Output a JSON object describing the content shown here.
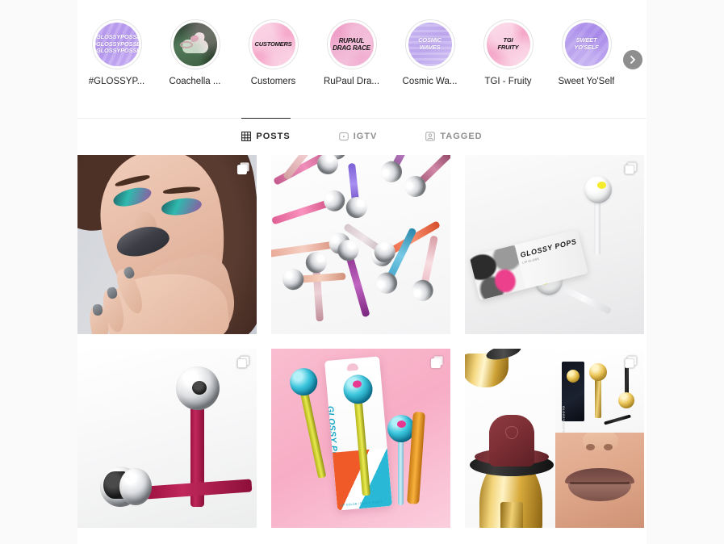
{
  "highlights": {
    "next_label": "Next",
    "items": [
      {
        "label": "#GLOSSYP...",
        "cover_text": "#GLOSSYPOSSE\n#GLOSSYPOSSE\n#GLOSSYPOSSE",
        "cover_class": "cov-glossyposse",
        "accent": "#b79bef"
      },
      {
        "label": "Coachella ...",
        "cover_text": "",
        "cover_class": "cov-coachella",
        "accent": "#3d5c45"
      },
      {
        "label": "Customers",
        "cover_text": "CUSTOMERS",
        "cover_class": "cov-customers",
        "accent": "#f6a9cb"
      },
      {
        "label": "RuPaul Dra...",
        "cover_text": "RUPAUL\nDRAG RACE",
        "cover_class": "cov-rupaul",
        "accent": "#eb96c2"
      },
      {
        "label": "Cosmic Wa...",
        "cover_text": "COSMIC\nWAVES",
        "cover_class": "cov-cosmic",
        "accent": "#bfa9ee"
      },
      {
        "label": "TGI - Fruity",
        "cover_text": "TGI\nFRUITY",
        "cover_class": "cov-tgi",
        "accent": "#f4a6c7"
      },
      {
        "label": "Sweet Yo'Self",
        "cover_text": "SWEET\nYO'SELF",
        "cover_class": "cov-sweet",
        "accent": "#a98bea"
      }
    ]
  },
  "tabs": [
    {
      "label": "POSTS",
      "icon": "grid-icon",
      "active": true
    },
    {
      "label": "IGTV",
      "icon": "igtv-icon",
      "active": false
    },
    {
      "label": "TAGGED",
      "icon": "tagged-icon",
      "active": false
    }
  ],
  "posts": [
    {
      "name": "post-makeup-model",
      "badge": "carousel-icon",
      "alt": "Model with teal smoky eye makeup and grey lipstick"
    },
    {
      "name": "post-gloss-wands",
      "badge": "none",
      "alt": "Scattered colorful lip gloss wands with chrome ball caps"
    },
    {
      "name": "post-glossy-pops-white",
      "badge": "carousel-icon",
      "alt": "Glossy Pops package with white and yellow lollipop applicators"
    },
    {
      "name": "post-burgundy-chrome",
      "badge": "carousel-icon",
      "alt": "Chrome lollipop lip gloss with burgundy wands"
    },
    {
      "name": "post-glossy-pops-pink",
      "badge": "carousel-icon",
      "alt": "Glossy Pops teal lollipop lip gloss on pink background"
    },
    {
      "name": "post-gold-lipstick",
      "badge": "carousel-icon",
      "alt": "Collage of gold lipstick bullet, product box and lips close-up"
    }
  ],
  "colors": {
    "background": "#fafafa",
    "content_background": "#ffffff",
    "text_primary": "#262626",
    "text_secondary": "#8e8e8e",
    "divider": "#efefef",
    "arrow_button": "#8e8e8e"
  }
}
